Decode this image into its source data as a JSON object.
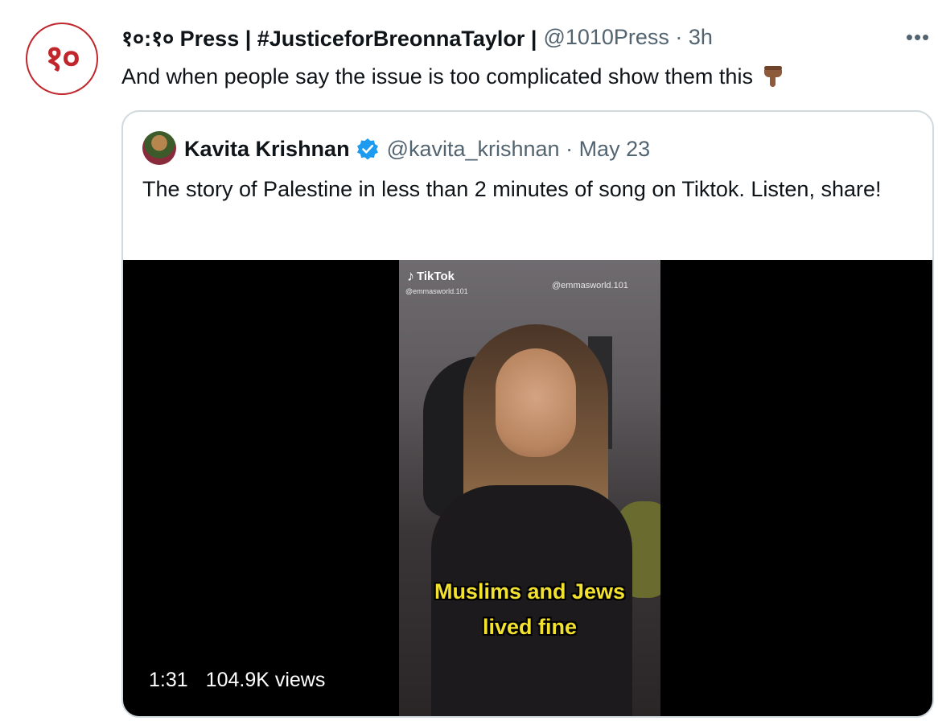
{
  "tweet": {
    "avatar_text": "१०",
    "display_name": "१०:१० Press | #JusticeforBreonnaTaylor |",
    "handle_time": "@1010Press · 3h",
    "more_label": "•••",
    "text": "And when people say the issue is too complicated show them this"
  },
  "quote": {
    "display_name": "Kavita Krishnan",
    "handle_time": "@kavita_krishnan · May 23",
    "text": "The story of Palestine in less than 2 minutes of song on Tiktok. Listen, share!",
    "video": {
      "tiktok_brand": "TikTok",
      "tiktok_handle_1": "@emmasworld.101",
      "tiktok_handle_2": "@emmasworld.101",
      "caption_line_1": "Muslims and Jews",
      "caption_line_2": "lived fine",
      "duration": "1:31",
      "views": "104.9K views"
    }
  },
  "colors": {
    "brand_red": "#c0262c",
    "verified_blue": "#1d9bf0",
    "secondary_text": "#536471",
    "caption_yellow": "#f2e12e"
  }
}
